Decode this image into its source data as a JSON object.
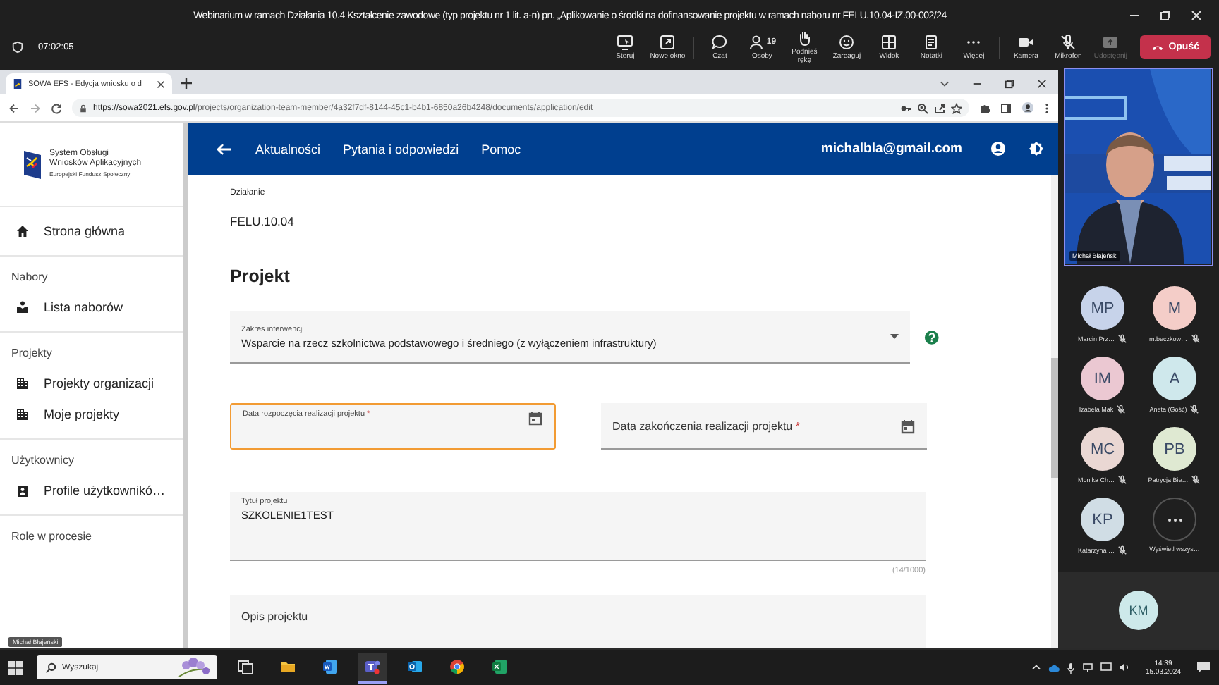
{
  "meeting": {
    "title": "Webinarium w ramach Działania 10.4 Kształcenie zawodowe (typ projektu nr 1 lit. a-n) pn. „Aplikowanie o środki na dofinansowanie projektu w ramach naboru nr FELU.10.04-IZ.00-002/24",
    "elapsed": "07:02:05"
  },
  "toolbar": [
    {
      "label": "Steruj",
      "disabled": false
    },
    {
      "label": "Nowe okno",
      "disabled": false
    },
    {
      "label": "Czat",
      "disabled": false
    },
    {
      "label": "Osoby",
      "count": "19",
      "disabled": false
    },
    {
      "label": "Podnieś rękę",
      "disabled": false
    },
    {
      "label": "Zareaguj",
      "disabled": false
    },
    {
      "label": "Widok",
      "disabled": false
    },
    {
      "label": "Notatki",
      "disabled": false
    },
    {
      "label": "Więcej",
      "disabled": false
    },
    {
      "label": "Kamera",
      "disabled": false
    },
    {
      "label": "Mikrofon",
      "disabled": false
    },
    {
      "label": "Udostępnij",
      "disabled": true
    }
  ],
  "leave_button": "Opuść",
  "browser": {
    "tab_title": "SOWA EFS - Edycja wniosku o d",
    "url_host": "https://sowa2021.efs.gov.pl",
    "url_path": "/projects/organization-team-member/4a32f7df-8144-45c1-b4b1-6850a26b4248/documents/application/edit"
  },
  "sidebar": {
    "logo_lines": [
      "System Obsługi",
      "Wniosków Aplikacyjnych",
      "Europejski Fundusz Społeczny"
    ],
    "groups": [
      {
        "items": [
          {
            "label": "Strona główna"
          }
        ]
      },
      {
        "heading": "Nabory",
        "items": [
          {
            "label": "Lista naborów"
          }
        ]
      },
      {
        "heading": "Projekty",
        "items": [
          {
            "label": "Projekty organizacji"
          },
          {
            "label": "Moje projekty"
          }
        ]
      },
      {
        "heading": "Użytkownicy",
        "items": [
          {
            "label": "Profile użytkownikó…"
          }
        ]
      },
      {
        "heading": "Role w procesie"
      }
    ]
  },
  "header": {
    "nav": [
      "Aktualności",
      "Pytania i odpowiedzi",
      "Pomoc"
    ],
    "user": "michalbla@gmail.com"
  },
  "form": {
    "action_label": "Działanie",
    "action_value": "FELU.10.04",
    "section_title": "Projekt",
    "intervention": {
      "label": "Zakres interwencji",
      "value": "Wsparcie na rzecz szkolnictwa podstawowego i średniego (z wyłączeniem infrastruktury)"
    },
    "dates": [
      {
        "label": "Data rozpoczęcia realizacji projektu",
        "required_mark": "*",
        "focused": true
      },
      {
        "label": "Data zakończenia realizacji projektu",
        "required_mark": "*",
        "focused": false
      }
    ],
    "title_field": {
      "label": "Tytuł projektu",
      "value": "SZKOLENIE1TEST",
      "counter": "(14/1000)"
    },
    "description_field": {
      "label": "Opis projektu"
    }
  },
  "presenter": {
    "name": "Michał Błajeński"
  },
  "participants": [
    {
      "initials": "MP",
      "name": "Marcin Prz…",
      "color": "#c7d3ea",
      "muted": true
    },
    {
      "initials": "M",
      "name": "m.beczkow…",
      "color": "#f4cdc8",
      "muted": true
    },
    {
      "initials": "IM",
      "name": "Izabela Mak",
      "color": "#ebc8d2",
      "muted": true
    },
    {
      "initials": "A",
      "name": "Aneta (Gość)",
      "color": "#cfe8ec",
      "muted": true
    },
    {
      "initials": "MC",
      "name": "Monika Ch…",
      "color": "#ead7d3",
      "muted": true
    },
    {
      "initials": "PB",
      "name": "Patrycja Bie…",
      "color": "#dfe9d2",
      "muted": true
    },
    {
      "initials": "KP",
      "name": "Katarzyna …",
      "color": "#d0dde5",
      "muted": true
    }
  ],
  "show_all": {
    "label": "Wyświetl wszys…"
  },
  "spotlight": {
    "initials": "KM",
    "color": "#cde9ea"
  },
  "hover_tooltip": "Michał Błajeński",
  "taskbar": {
    "search_placeholder": "Wyszukaj",
    "apps": [
      {
        "selected": false
      },
      {
        "selected": false
      },
      {
        "selected": false
      },
      {
        "selected": true
      },
      {
        "selected": false
      },
      {
        "selected": false
      },
      {
        "selected": false
      }
    ],
    "time": "14:39",
    "date": "15.03.2024"
  }
}
